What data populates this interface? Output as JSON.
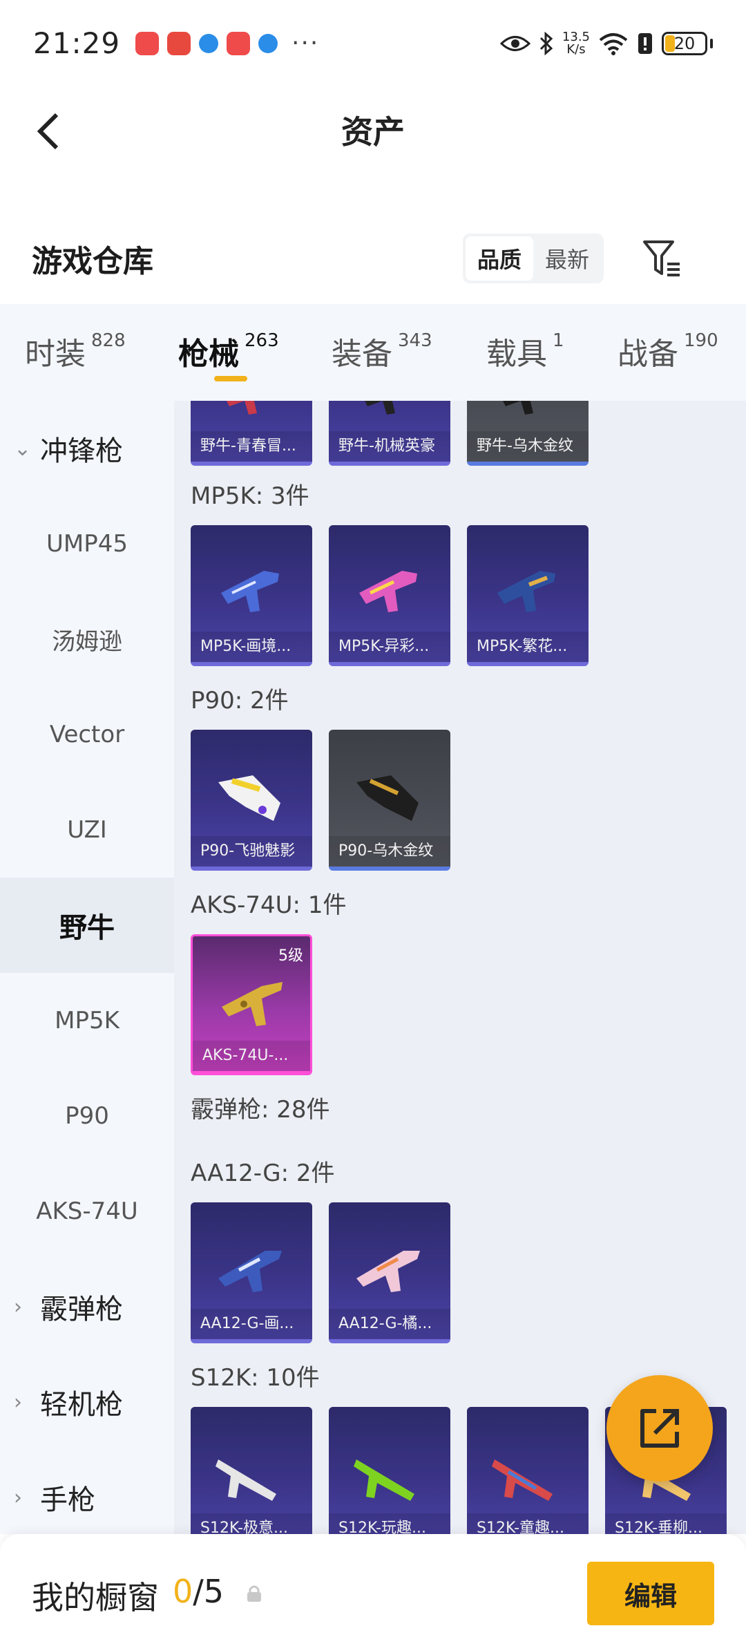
{
  "status_bar": {
    "time": "21:29",
    "net_speed_value": "13.5",
    "net_speed_unit": "K/s",
    "battery": "20",
    "more": "···",
    "icons": [
      "app-red-icon",
      "app-red-icon",
      "app-blue-icon",
      "app-red-icon",
      "app-blue-icon",
      "eye-icon",
      "bluetooth-icon",
      "wifi-icon",
      "alert-icon",
      "battery-icon"
    ]
  },
  "nav": {
    "title": "资产",
    "back_icon": "chevron-left-icon"
  },
  "warehouse": {
    "title": "游戏仓库",
    "sort": [
      "品质",
      "最新"
    ],
    "sort_active": "品质",
    "filter_icon": "filter-icon"
  },
  "tabs": [
    {
      "label": "时装",
      "count": "828"
    },
    {
      "label": "枪械",
      "count": "263",
      "active": true
    },
    {
      "label": "装备",
      "count": "343"
    },
    {
      "label": "载具",
      "count": "1"
    },
    {
      "label": "战备",
      "count": "190"
    }
  ],
  "sidebar": {
    "groups": [
      {
        "label": "冲锋枪",
        "expanded": true
      },
      {
        "label": "霰弹枪",
        "expanded": false
      },
      {
        "label": "轻机枪",
        "expanded": false
      },
      {
        "label": "手枪",
        "expanded": false
      }
    ],
    "items": [
      "UMP45",
      "汤姆逊",
      "Vector",
      "UZI",
      "野牛",
      "MP5K",
      "P90",
      "AKS-74U"
    ],
    "selected": "野牛"
  },
  "content": {
    "partial_row": [
      "野牛-青春冒...",
      "野牛-机械英豪",
      "野牛-乌木金纹"
    ],
    "sections": [
      {
        "title": "MP5K: 3件",
        "cards": [
          "MP5K-画境...",
          "MP5K-异彩...",
          "MP5K-繁花..."
        ]
      },
      {
        "title": "P90: 2件",
        "cards": [
          "P90-飞驰魅影",
          "P90-乌木金纹"
        ]
      },
      {
        "title": "AKS-74U: 1件",
        "cards": [
          "AKS-74U-..."
        ],
        "level": "5级"
      },
      {
        "title": "霰弹枪: 28件",
        "cards": []
      },
      {
        "title": "AA12-G: 2件",
        "cards": [
          "AA12-G-画...",
          "AA12-G-橘..."
        ]
      },
      {
        "title": "S12K: 10件",
        "cards": [
          "S12K-极意...",
          "S12K-玩趣...",
          "S12K-童趣...",
          "S12K-垂柳..."
        ]
      }
    ]
  },
  "fab": {
    "icon": "external-link-icon"
  },
  "bottom": {
    "title": "我的橱窗",
    "used": "0",
    "total": "/5",
    "lock_icon": "lock-icon",
    "edit_label": "编辑"
  },
  "colors": {
    "accent": "#f2b21b",
    "card_purple": "#3b3488",
    "card_gray": "#4a4c55",
    "card_pink": "#c640c0",
    "page_bg": "#eceff5"
  }
}
